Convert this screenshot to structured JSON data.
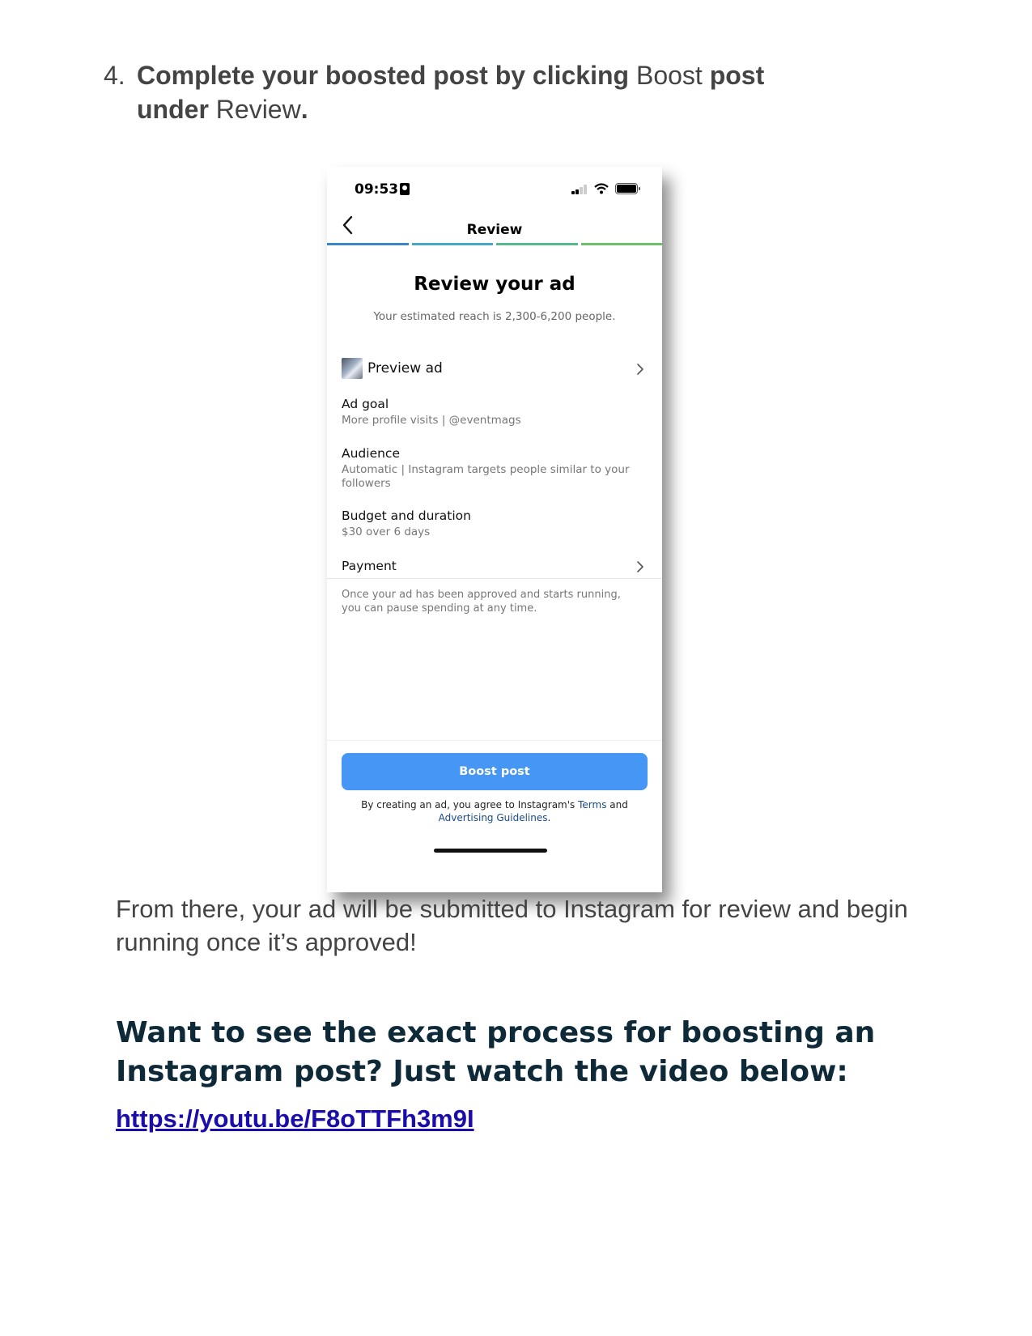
{
  "step": {
    "number": "4.",
    "parts": [
      {
        "text": "Complete your boosted post by clicking ",
        "bold": true
      },
      {
        "text": "Boost",
        "bold": false
      },
      {
        "text": " post",
        "bold": true
      },
      {
        "text": "under",
        "bold": true,
        "break_before": true
      },
      {
        "text": " Review",
        "bold": false
      },
      {
        "text": ".",
        "bold": true
      }
    ]
  },
  "phone": {
    "status": {
      "time": "09:53"
    },
    "nav": {
      "title": "Review"
    },
    "progress_colors": [
      "#3a86c8",
      "#46a8c4",
      "#55b98a",
      "#6cc16a"
    ],
    "review": {
      "title": "Review your ad",
      "reach": "Your estimated reach is 2,300-6,200 people."
    },
    "preview": {
      "label": "Preview ad"
    },
    "ad_goal": {
      "label": "Ad goal",
      "value": "More profile visits | @eventmags"
    },
    "audience": {
      "label": "Audience",
      "value": "Automatic | Instagram targets people similar to your followers"
    },
    "budget": {
      "label": "Budget and duration",
      "value": "$30 over 6 days"
    },
    "payment": {
      "label": "Payment"
    },
    "note": "Once your ad has been approved and starts running, you can pause spending at any time.",
    "boost_button": "Boost post",
    "terms": {
      "prefix": "By creating an ad, you agree to Instagram's ",
      "terms_link": "Terms",
      "middle": " and ",
      "guidelines_link": "Advertising Guidelines",
      "suffix": "."
    }
  },
  "after_text": "From there, your ad will be submitted to Instagram for review and begin running once it’s approved!",
  "headline": "Want to see the exact process for boosting an Instagram post? Just watch the video below:",
  "video_link": "https://youtu.be/F8oTTFh3m9I"
}
